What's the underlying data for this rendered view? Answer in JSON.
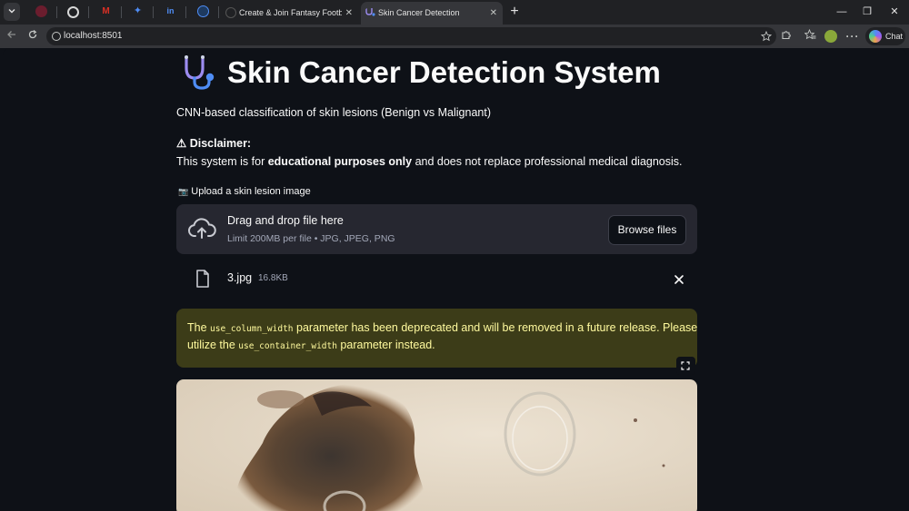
{
  "browser": {
    "tabs": [
      {
        "label": "Create & Join Fantasy Football Lea",
        "close": "✕"
      },
      {
        "label": "Skin Cancer Detection",
        "close": "✕"
      }
    ],
    "new_tab": "+",
    "url": "localhost:8501",
    "chat_label": "Chat",
    "window_controls": {
      "minimize": "—",
      "restore": "❐",
      "close": "✕"
    }
  },
  "app": {
    "title": "Skin Cancer Detection System",
    "title_icon": "stethoscope-icon",
    "subtitle": "CNN-based classification of skin lesions (Benign vs Malignant)",
    "disclaimer_icon": "⚠",
    "disclaimer_heading": "Disclaimer:",
    "disclaimer_pre": "This system is for ",
    "disclaimer_bold": "educational purposes only",
    "disclaimer_post": " and does not replace professional medical diagnosis."
  },
  "uploader": {
    "label_icon": "📷",
    "label": "Upload a skin lesion image",
    "drop_text": "Drag and drop file here",
    "limit_text": "Limit 200MB per file • JPG, JPEG, PNG",
    "browse_label": "Browse files"
  },
  "file": {
    "name": "3.jpg",
    "size": "16.8KB"
  },
  "warning": {
    "t1": "The ",
    "c1": "use_column_width",
    "t2": " parameter has been deprecated and will be removed in a future release. Please",
    "t3": "utilize the ",
    "c2": "use_container_width",
    "t4": " parameter instead."
  },
  "colors": {
    "background": "#0e1117",
    "widget_bg": "#262730",
    "warning_bg": "#3c3c18",
    "warning_text": "#fffa9e",
    "accent_blue": "#4f8df5"
  }
}
